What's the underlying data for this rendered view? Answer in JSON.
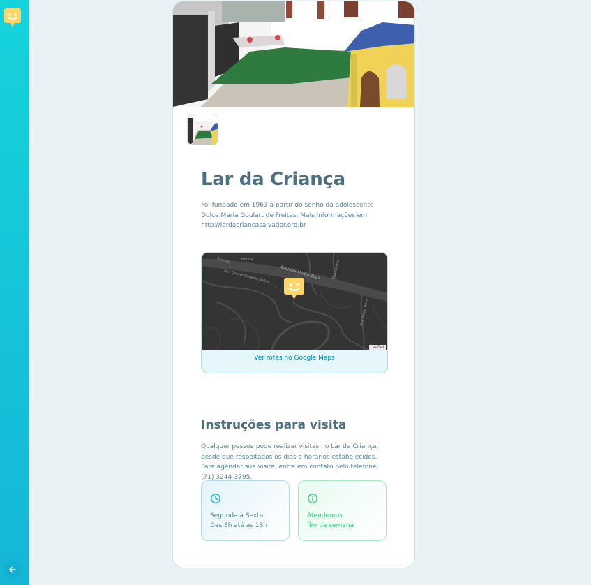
{
  "place": {
    "name": "Lar da Criança",
    "description": "Foi fundado em 1963 a partir do sonho da adolescente Dulce Maria Goulart de Freitas. Mais informações em: http://lardacriancasalvador.org.br"
  },
  "map": {
    "streets": [
      "Avenida Heitor Dias",
      "Rua Doutor Genésio Salles",
      "Honda",
      "Rua Carmo",
      "Rua Varge Novo",
      "Avenida"
    ],
    "attribution": "Leaflet",
    "directions_label": "Ver rotas no Google Maps"
  },
  "visit": {
    "title": "Instruções para visita",
    "instructions": "Qualquer pessoa pode realizar visitas no Lar da Criança, desde que respeitados os dias e horários estabelecidos. Para agendar sua visita, entre em contato pelo telefone: (71) 3244-3795.",
    "hours_line1": "Segunda à Sexta",
    "hours_line2": "Das 8h até as 18h",
    "weekend_line1": "Atendemos",
    "weekend_line2": "fim de semana"
  },
  "colors": {
    "sidebar": "#15c3da",
    "title": "#4d6f80",
    "link": "#0089a5",
    "weekend": "#37c77f",
    "marker": "#ffd666"
  },
  "icons": {
    "logo": "happy-marker-icon",
    "back": "arrow-left-icon",
    "hours": "clock-icon",
    "weekend": "info-icon"
  }
}
